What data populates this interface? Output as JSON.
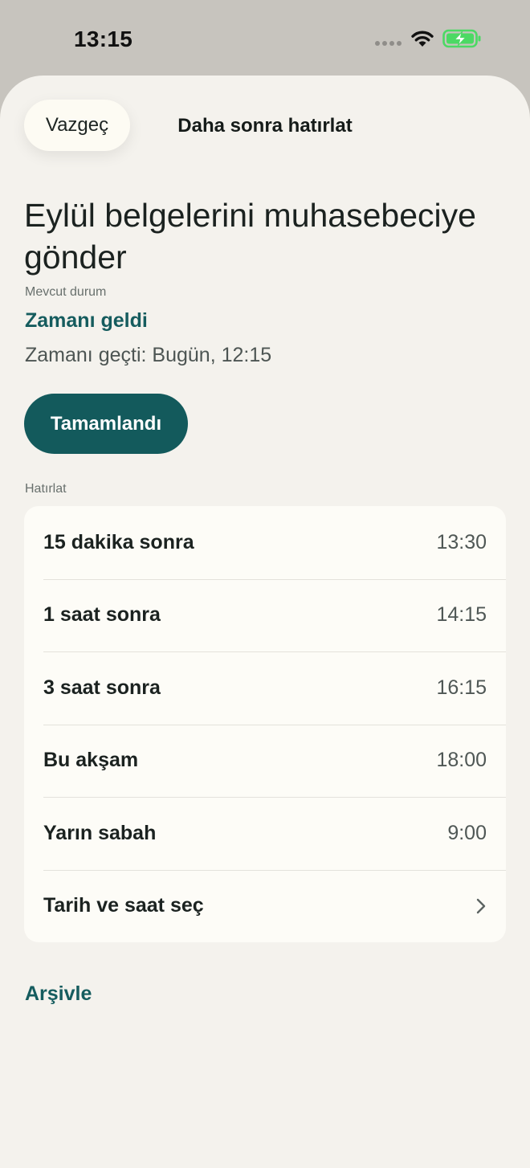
{
  "status_bar": {
    "time": "13:15",
    "icons": [
      "signal-dots-icon",
      "wifi-icon",
      "battery-charging-icon"
    ],
    "battery_color": "#4cd964"
  },
  "header": {
    "cancel_label": "Vazgeç",
    "title": "Daha sonra hatırlat"
  },
  "task": {
    "title": "Eylül belgelerini muhasebeciye gönder",
    "state_label": "Mevcut durum",
    "state_value": "Zamanı geldi",
    "overdue": "Zamanı geçti: Bugün, 12:15"
  },
  "complete_button": "Tamamlandı",
  "reminders": {
    "label": "Hatırlat",
    "options": [
      {
        "label": "15 dakika sonra",
        "time": "13:30"
      },
      {
        "label": "1 saat sonra",
        "time": "14:15"
      },
      {
        "label": "3 saat sonra",
        "time": "16:15"
      },
      {
        "label": "Bu akşam",
        "time": "18:00"
      },
      {
        "label": "Yarın sabah",
        "time": "9:00"
      }
    ],
    "custom_label": "Tarih ve saat seç",
    "custom_icon": "chevron-right-icon"
  },
  "archive_label": "Arşivle",
  "colors": {
    "accent": "#135a5c",
    "sheet_background": "#f4f2ed",
    "card_background": "#fdfcf7"
  }
}
